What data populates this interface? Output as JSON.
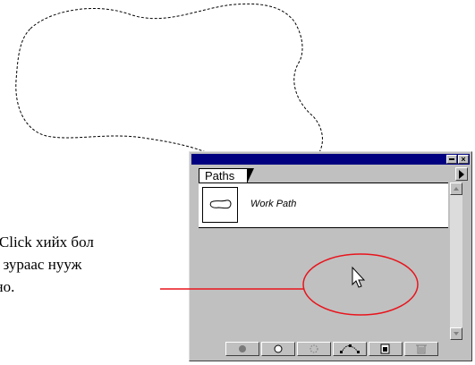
{
  "annotation": {
    "lines": [
      "д Click хийх бол",
      "th зураас нууж",
      "лно."
    ]
  },
  "palette": {
    "tab_label": "Paths",
    "paths": [
      {
        "name": "Work Path"
      }
    ],
    "titlebar_buttons": [
      "minimize",
      "close"
    ],
    "bottom_buttons": [
      {
        "icon": "fill-path-icon"
      },
      {
        "icon": "stroke-path-icon"
      },
      {
        "icon": "load-selection-icon"
      },
      {
        "icon": "make-work-path-icon"
      },
      {
        "icon": "new-path-icon"
      },
      {
        "icon": "trash-icon"
      }
    ]
  },
  "colors": {
    "titlebar": "#000080",
    "panel": "#c0c0c0",
    "highlight_ellipse": "#e8141c",
    "pointer_line": "#e8141c"
  }
}
